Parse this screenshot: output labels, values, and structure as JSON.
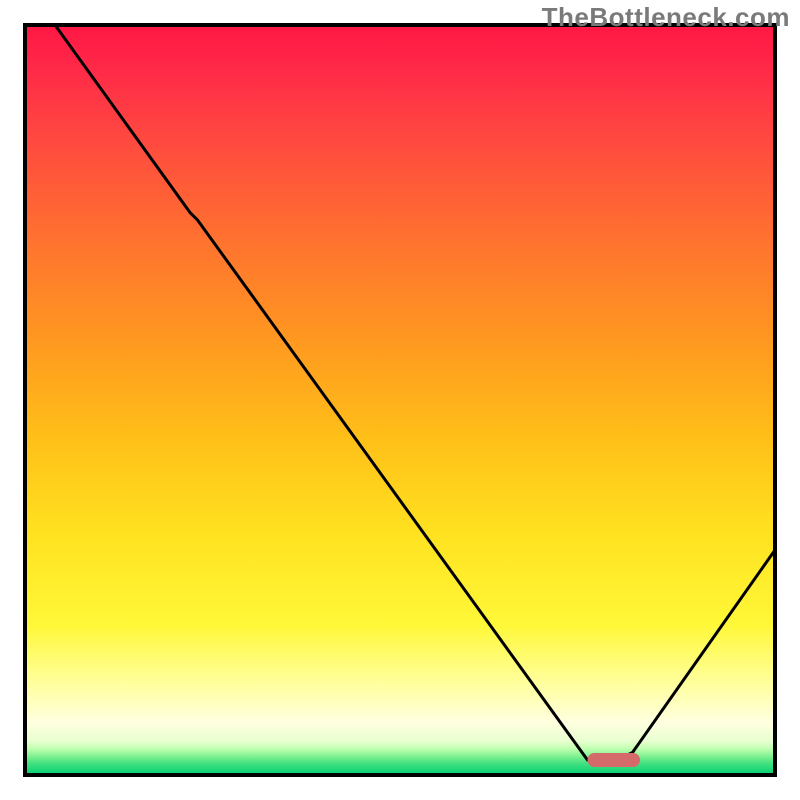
{
  "watermark": "TheBottleneck.com",
  "chart_data": {
    "type": "line",
    "title": "",
    "xlabel": "",
    "ylabel": "",
    "xlim": [
      0,
      100
    ],
    "ylim": [
      0,
      100
    ],
    "x": [
      4,
      22,
      23,
      75,
      78,
      79,
      81,
      100
    ],
    "y": [
      100,
      75,
      74,
      2,
      2,
      2,
      3,
      30
    ],
    "marker": {
      "x_range": [
        75,
        82
      ],
      "y": 2,
      "color": "#d46a6a"
    },
    "gradient_stops": [
      {
        "pos": 0.0,
        "color": "#ff1744"
      },
      {
        "pos": 0.06,
        "color": "#ff2a48"
      },
      {
        "pos": 0.15,
        "color": "#ff4840"
      },
      {
        "pos": 0.28,
        "color": "#ff7030"
      },
      {
        "pos": 0.42,
        "color": "#ff9820"
      },
      {
        "pos": 0.55,
        "color": "#ffbf18"
      },
      {
        "pos": 0.68,
        "color": "#ffe220"
      },
      {
        "pos": 0.8,
        "color": "#fff838"
      },
      {
        "pos": 0.88,
        "color": "#ffffa0"
      },
      {
        "pos": 0.93,
        "color": "#ffffe0"
      },
      {
        "pos": 0.955,
        "color": "#e8ffd0"
      },
      {
        "pos": 0.965,
        "color": "#c0ffb0"
      },
      {
        "pos": 0.975,
        "color": "#80f090"
      },
      {
        "pos": 0.985,
        "color": "#40e080"
      },
      {
        "pos": 1.0,
        "color": "#00d070"
      }
    ]
  }
}
